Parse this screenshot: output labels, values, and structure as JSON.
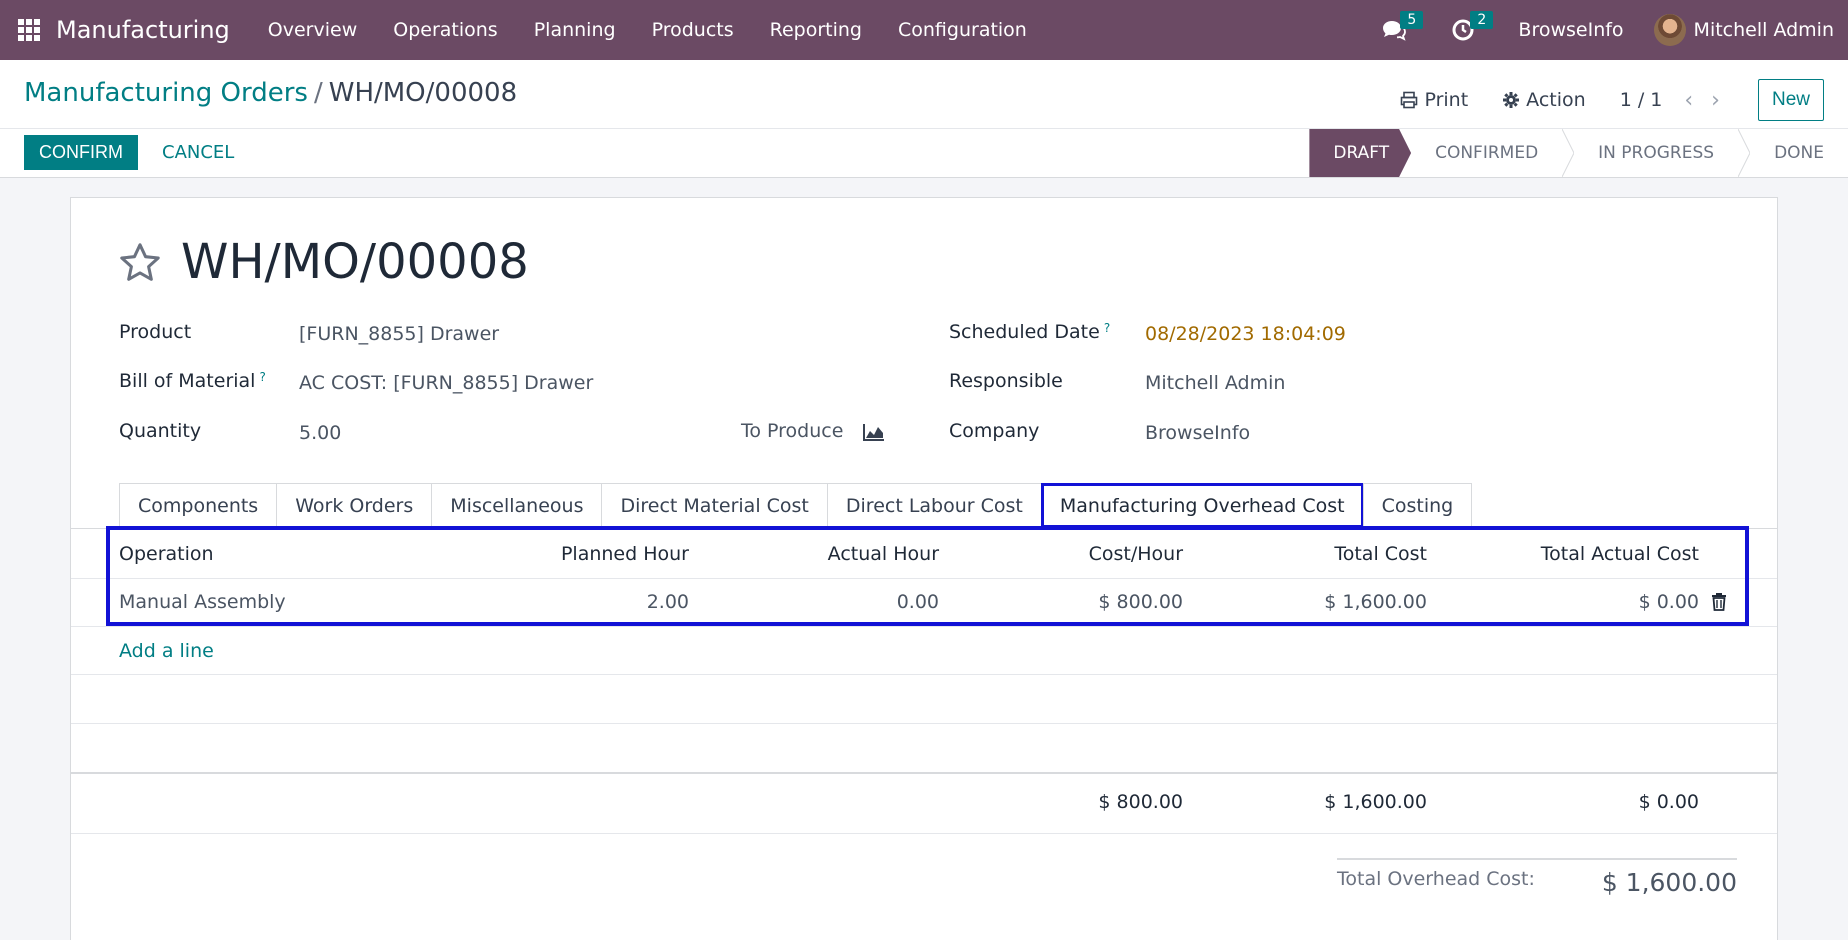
{
  "navbar": {
    "app_name": "Manufacturing",
    "menu": [
      "Overview",
      "Operations",
      "Planning",
      "Products",
      "Reporting",
      "Configuration"
    ],
    "messages_count": "5",
    "activities_count": "2",
    "company": "BrowseInfo",
    "user": "Mitchell Admin"
  },
  "control": {
    "breadcrumb_parent": "Manufacturing Orders",
    "breadcrumb_sep": "/",
    "breadcrumb_current": "WH/MO/00008",
    "print_label": "Print",
    "action_label": "Action",
    "pager": "1 / 1",
    "new_label": "New",
    "confirm_label": "CONFIRM",
    "cancel_label": "CANCEL",
    "stages": [
      "DRAFT",
      "CONFIRMED",
      "IN PROGRESS",
      "DONE"
    ],
    "active_stage": "DRAFT"
  },
  "record": {
    "title": "WH/MO/00008",
    "product_label": "Product",
    "product_value": "[FURN_8855] Drawer",
    "bom_label": "Bill of Material",
    "bom_value": "AC COST: [FURN_8855] Drawer",
    "quantity_label": "Quantity",
    "quantity_value": "5.00",
    "to_produce_label": "To Produce",
    "scheduled_label": "Scheduled Date",
    "scheduled_value": "08/28/2023 18:04:09",
    "responsible_label": "Responsible",
    "responsible_value": "Mitchell Admin",
    "company_label": "Company",
    "company_value": "BrowseInfo",
    "help_mark": "?"
  },
  "tabs": {
    "items": [
      "Components",
      "Work Orders",
      "Miscellaneous",
      "Direct Material Cost",
      "Direct Labour Cost",
      "Manufacturing Overhead Cost",
      "Costing"
    ],
    "active": "Manufacturing Overhead Cost"
  },
  "table": {
    "headers": [
      "Operation",
      "Planned Hour",
      "Actual Hour",
      "Cost/Hour",
      "Total Cost",
      "Total Actual Cost"
    ],
    "rows": [
      [
        "Manual Assembly",
        "2.00",
        "0.00",
        "$ 800.00",
        "$ 1,600.00",
        "$ 0.00"
      ]
    ],
    "add_line": "Add a line",
    "footer": {
      "cost_hour": "$ 800.00",
      "total_cost": "$ 1,600.00",
      "total_actual": "$ 0.00"
    },
    "total_overhead_label": "Total Overhead Cost:",
    "total_overhead_value": "$ 1,600.00"
  },
  "colors": {
    "navbar": "#6b4a64",
    "accent": "#017e84",
    "highlight": "#1212d6"
  }
}
